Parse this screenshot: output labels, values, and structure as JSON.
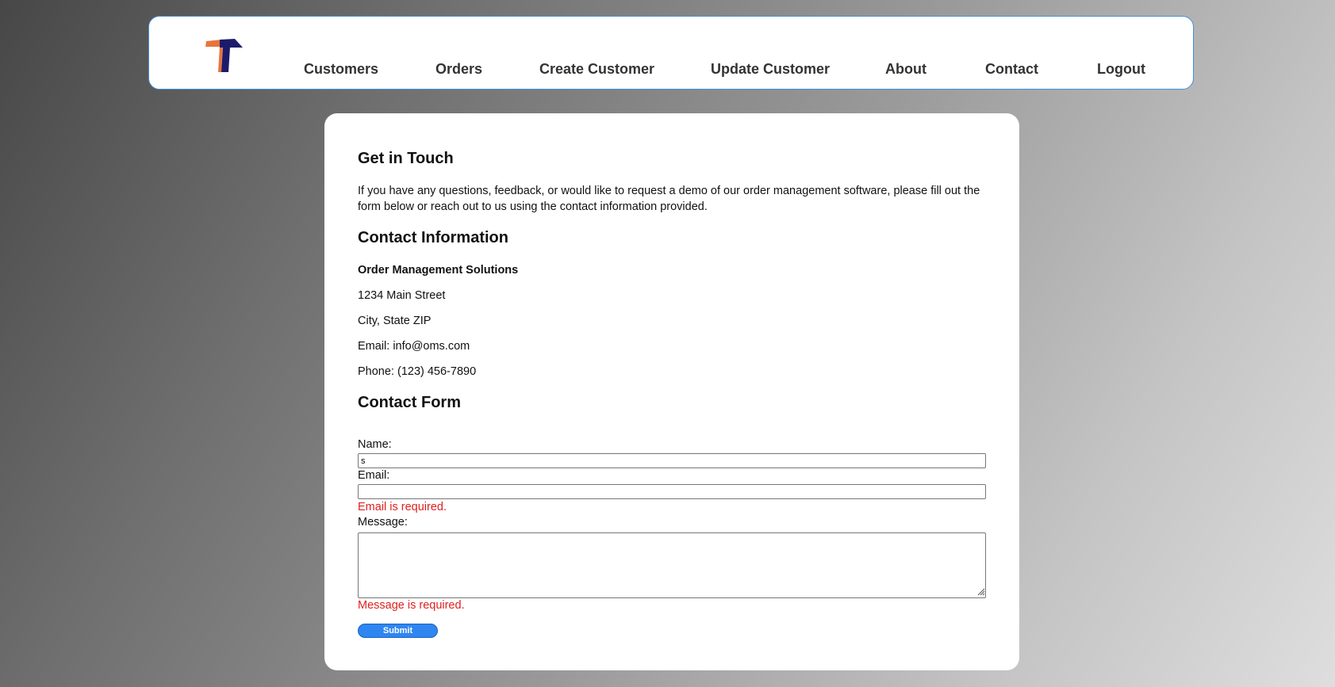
{
  "header": {
    "logo_icon": "t-letter-logo-icon",
    "nav": [
      {
        "label": "Customers"
      },
      {
        "label": "Orders"
      },
      {
        "label": "Create Customer"
      },
      {
        "label": "Update Customer"
      },
      {
        "label": "About"
      },
      {
        "label": "Contact"
      },
      {
        "label": "Logout"
      }
    ]
  },
  "intro": {
    "title": "Get in Touch",
    "text": "If you have any questions, feedback, or would like to request a demo of our order management software, please fill out the form below or reach out to us using the contact information provided."
  },
  "contact_info": {
    "title": "Contact Information",
    "company": "Order Management Solutions",
    "street": "1234 Main Street",
    "city": "City, State ZIP",
    "email": "Email: info@oms.com",
    "phone": "Phone: (123) 456-7890"
  },
  "form": {
    "title": "Contact Form",
    "name_label": "Name:",
    "name_value": "s",
    "email_label": "Email:",
    "email_value": "",
    "email_error": "Email is required.",
    "message_label": "Message:",
    "message_value": "",
    "message_error": "Message is required.",
    "submit_label": "Submit"
  },
  "colors": {
    "accent": "#2f86f0",
    "error": "#e01f1f",
    "logo_orange": "#e8743b",
    "logo_navy": "#1c1b6b",
    "header_border": "#4a8fd6"
  }
}
